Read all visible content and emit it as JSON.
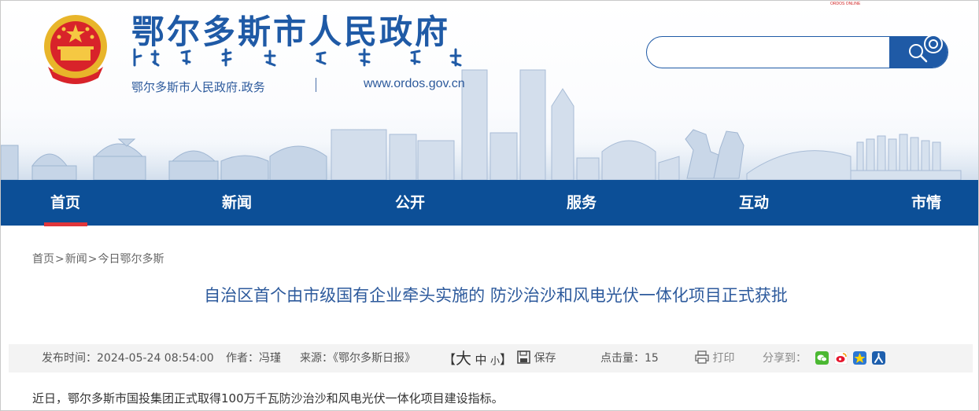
{
  "header": {
    "site_title": "鄂尔多斯市人民政府",
    "subtitle": "鄂尔多斯市人民政府.政务",
    "url": "www.ordos.gov.cn",
    "tiny_tag": "ORDOS ONLINE",
    "search": {
      "value": "",
      "placeholder": ""
    }
  },
  "nav": {
    "items": [
      {
        "label": "首页"
      },
      {
        "label": "新闻"
      },
      {
        "label": "公开"
      },
      {
        "label": "服务"
      },
      {
        "label": "互动"
      },
      {
        "label": "市情"
      }
    ],
    "active_index": 0
  },
  "breadcrumb": {
    "items": [
      "首页",
      "新闻",
      "今日鄂尔多斯"
    ],
    "separator": ">"
  },
  "article": {
    "title": "自治区首个由市级国有企业牵头实施的 防沙治沙和风电光伏一体化项目正式获批",
    "publish_label": "发布时间：",
    "publish_time": "2024-05-24 08:54:00",
    "author_label": "作者：",
    "author": "冯瑾",
    "source_label": "来源：",
    "source": "《鄂尔多斯日报》",
    "font_open": "【",
    "font_big": "大",
    "font_mid": "中",
    "font_small": "小",
    "font_close": "】",
    "save_label": "保存",
    "clicks_label": "点击量：",
    "clicks": "15",
    "print_label": "打印",
    "share_label": "分享到：",
    "body_first_line": "近日，鄂尔多斯市国投集团正式取得100万千瓦防沙治沙和风电光伏一体化项目建设指标。"
  },
  "colors": {
    "brand_blue": "#1f5aa6",
    "nav_blue": "#0c4f97",
    "active_red": "#e0353b",
    "title_blue": "#2d5a9c"
  },
  "icons": {
    "search": "search-icon",
    "save": "save-icon",
    "print": "printer-icon",
    "share": [
      "wechat-icon",
      "weibo-icon",
      "qzone-icon",
      "renren-icon"
    ]
  }
}
